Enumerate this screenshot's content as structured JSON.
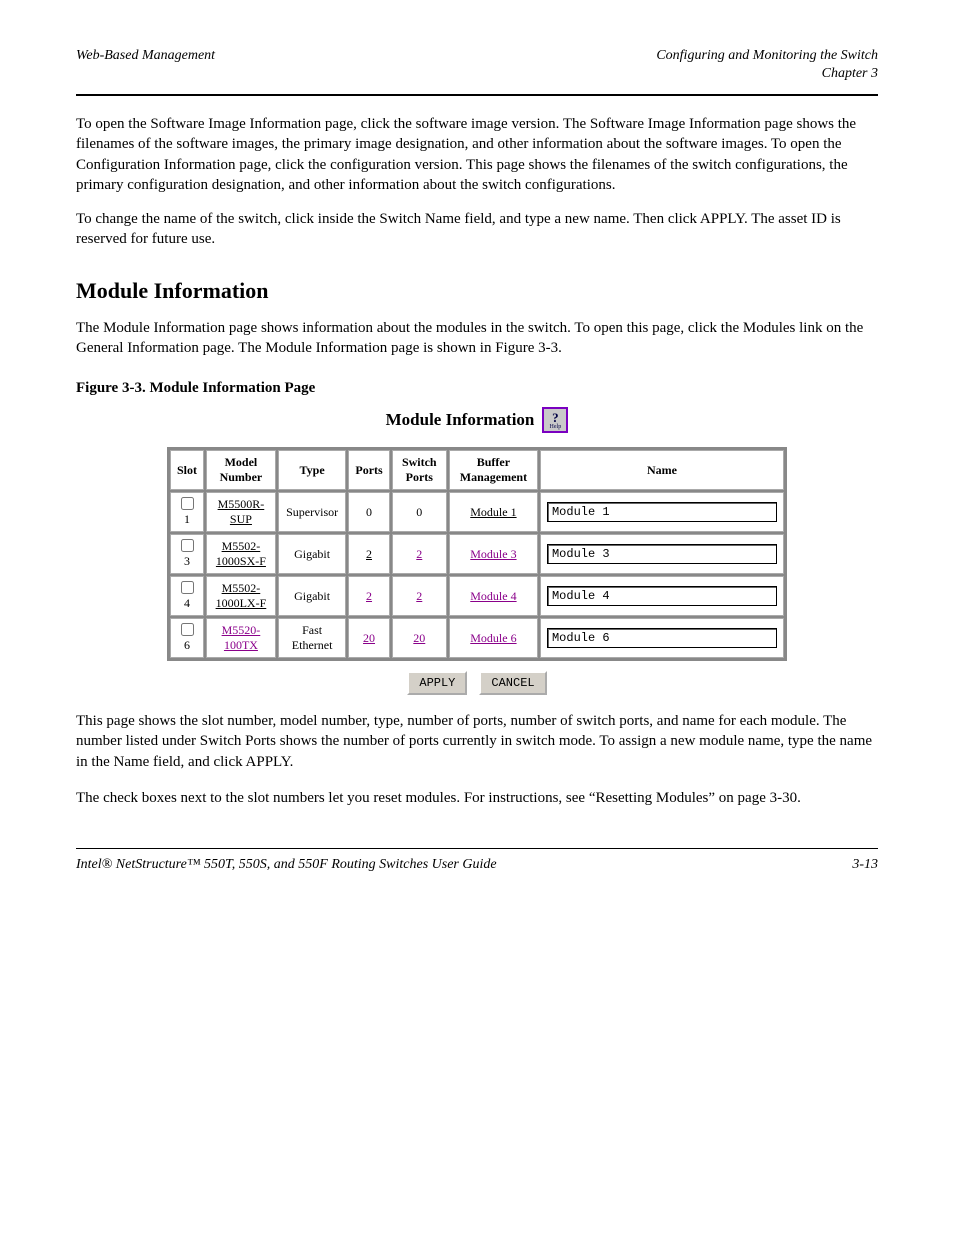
{
  "header": {
    "left": "Web-Based Management",
    "right": "Configuring and Monitoring the Switch",
    "chapter": "Chapter 3"
  },
  "intro": {
    "p1": "To open the Software Image Information page, click the software image version. The Software Image Information page shows the filenames of the software images, the primary image designation, and other information about the software images. To open the Configuration Information page, click the configuration version. This page shows the filenames of the switch configurations, the primary configuration designation, and other information about the switch configurations.",
    "p2": "To change the name of the switch, click inside the Switch Name field, and type a new name. Then click APPLY. The asset ID is reserved for future use."
  },
  "section": {
    "title": "Module Information",
    "p": "The Module Information page shows information about the modules in the switch. To open this page, click the Modules link on the General Information page. The Module Information page is shown in Figure 3-3."
  },
  "figure": {
    "caption": "Figure 3-3. Module Information Page",
    "panel_title": "Module Information",
    "help_label": "Help",
    "headers": {
      "slot": "Slot",
      "model": "Model Number",
      "type": "Type",
      "ports": "Ports",
      "switch_ports": "Switch Ports",
      "buffer": "Buffer Management",
      "name": "Name"
    },
    "rows": [
      {
        "slot": "1",
        "model": "M5500R-SUP",
        "model_link": "u",
        "type": "Supervisor",
        "ports": "0",
        "ports_link": "",
        "sports": "0",
        "sports_link": "",
        "buffer": "Module 1",
        "buffer_link": "u",
        "name": "Module 1"
      },
      {
        "slot": "3",
        "model": "M5502-1000SX-F",
        "model_link": "u",
        "type": "Gigabit",
        "ports": "2",
        "ports_link": "u",
        "sports": "2",
        "sports_link": "p",
        "buffer": "Module 3",
        "buffer_link": "p",
        "name": "Module 3"
      },
      {
        "slot": "4",
        "model": "M5502-1000LX-F",
        "model_link": "u",
        "type": "Gigabit",
        "ports": "2",
        "ports_link": "p",
        "sports": "2",
        "sports_link": "p",
        "buffer": "Module 4",
        "buffer_link": "p",
        "name": "Module 4"
      },
      {
        "slot": "6",
        "model": "M5520-100TX",
        "model_link": "p",
        "type": "Fast Ethernet",
        "ports": "20",
        "ports_link": "p",
        "sports": "20",
        "sports_link": "p",
        "buffer": "Module 6",
        "buffer_link": "p",
        "name": "Module 6"
      }
    ],
    "buttons": {
      "apply": "APPLY",
      "cancel": "CANCEL"
    }
  },
  "after": {
    "p1": "This page shows the slot number, model number, type, number of ports, number of switch ports, and name for each module. The number listed under Switch Ports shows the number of ports currently in switch mode. To assign a new module name, type the name in the Name field, and click APPLY.",
    "p2": "The check boxes next to the slot numbers let you reset modules. For instructions, see “Resetting Modules” on page 3-30."
  },
  "footer": {
    "left": "Intel® NetStructure™ 550T, 550S, and 550F Routing Switches User Guide",
    "right": "3-13"
  }
}
